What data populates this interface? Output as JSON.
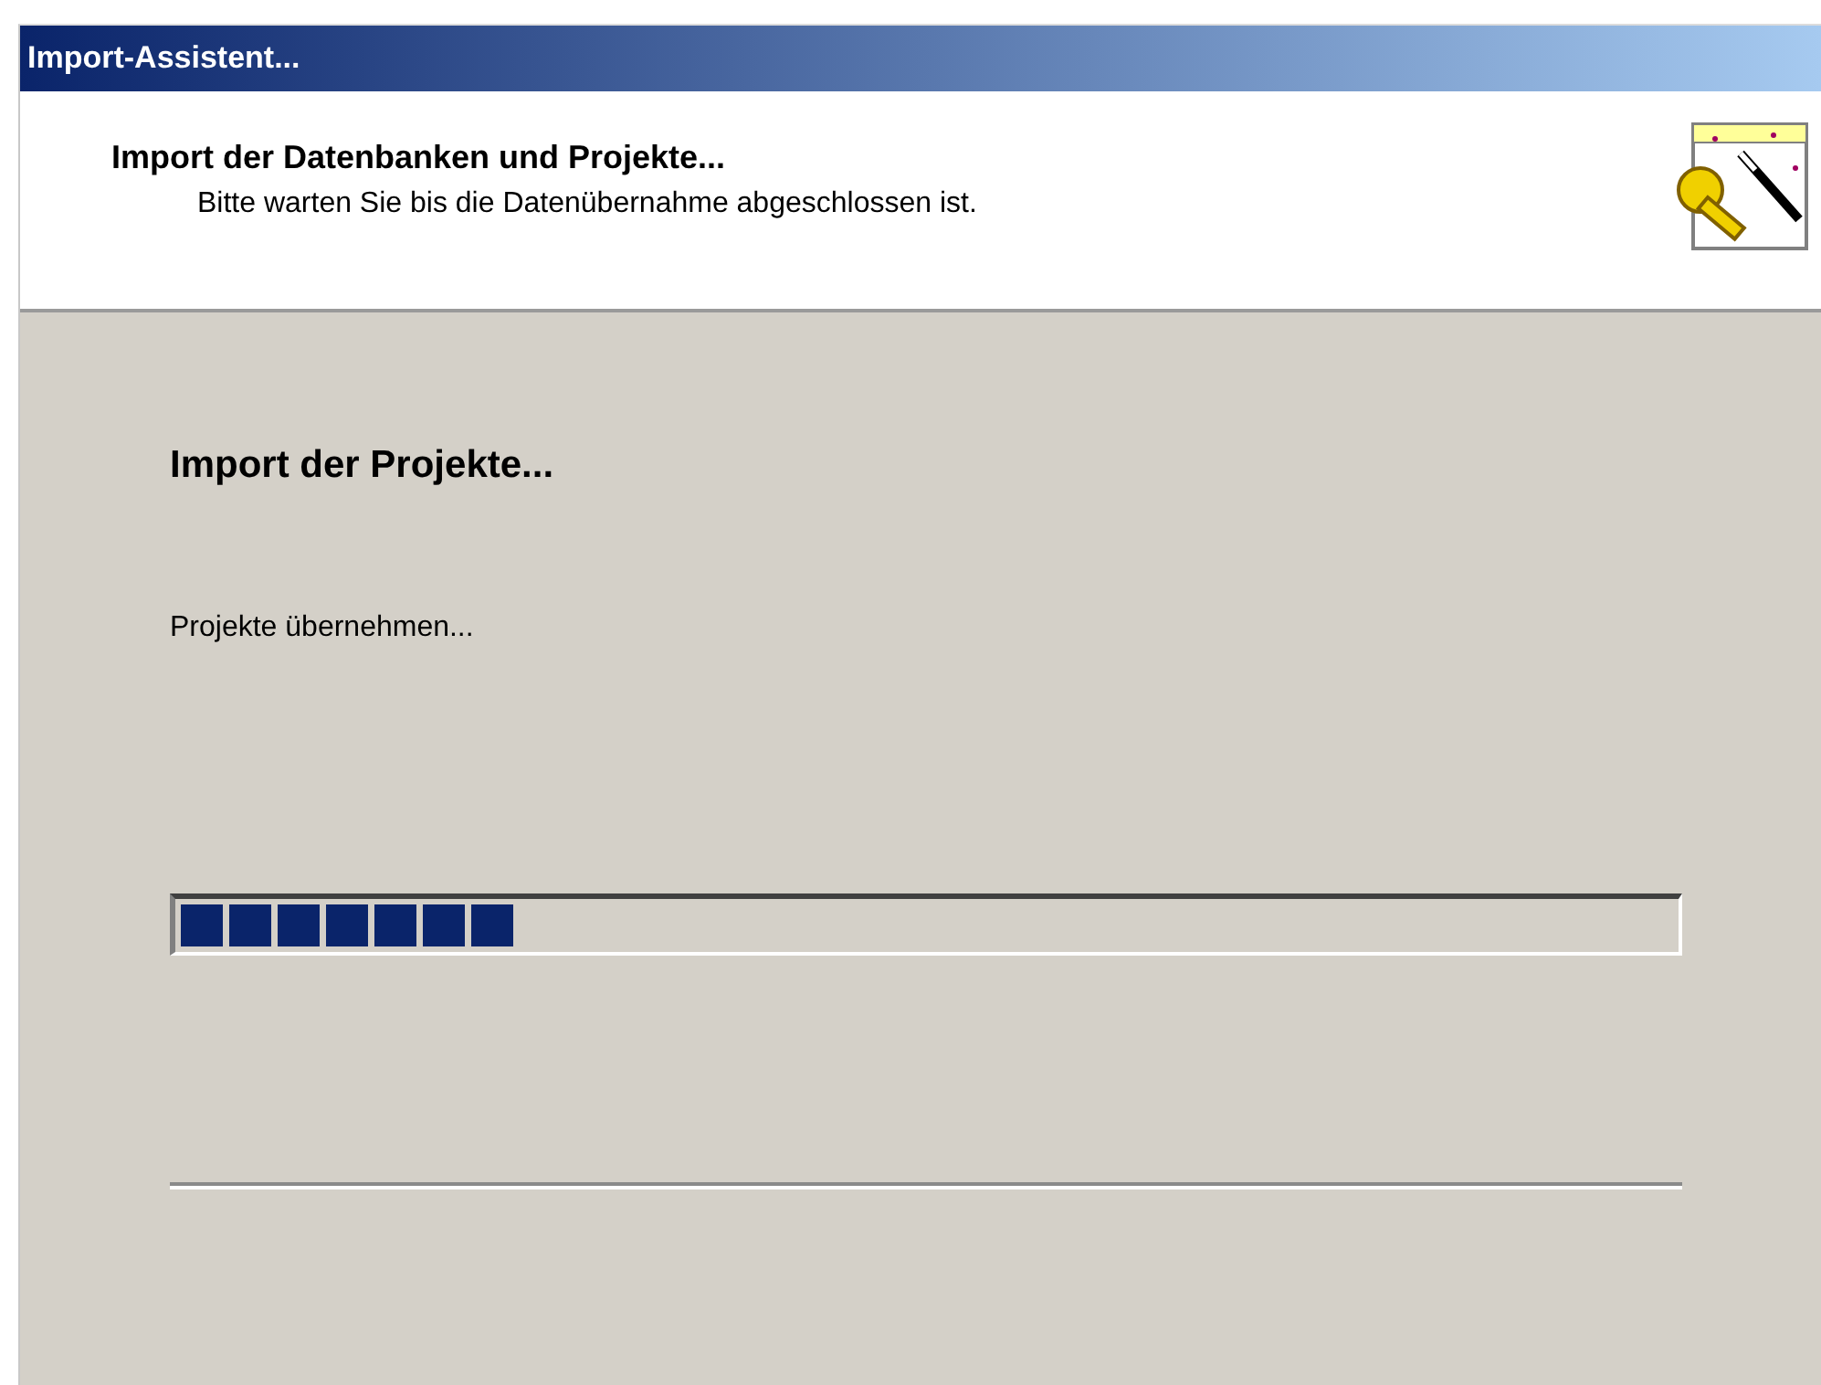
{
  "window": {
    "title": "Import-Assistent..."
  },
  "header": {
    "title": "Import der Datenbanken und Projekte...",
    "subtitle": "Bitte warten Sie bis die Datenübernahme abgeschlossen ist."
  },
  "step": {
    "title": "Import der Projekte...",
    "status": "Projekte übernehmen..."
  },
  "progress": {
    "level": 0.225
  }
}
